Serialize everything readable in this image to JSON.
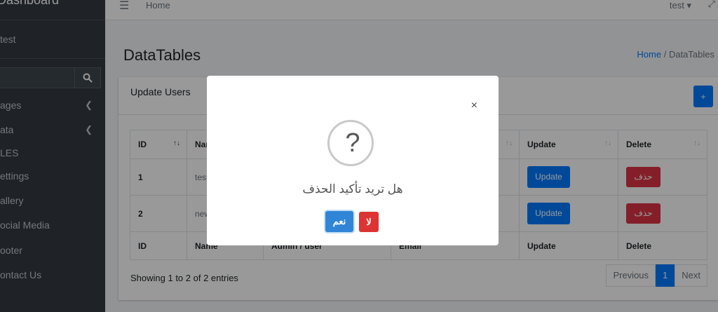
{
  "sidebar": {
    "brand": "Dashboard",
    "user_name": "test",
    "items": [
      {
        "label": "ages",
        "has_chevron": true
      },
      {
        "label": "ata",
        "has_chevron": true
      },
      {
        "label": "LES",
        "has_chevron": false
      },
      {
        "label": "ettings",
        "has_chevron": false
      },
      {
        "label": "allery",
        "has_chevron": false
      },
      {
        "label": "ocial Media",
        "has_chevron": false
      },
      {
        "label": "ooter",
        "has_chevron": false
      },
      {
        "label": "ontact Us",
        "has_chevron": false
      }
    ]
  },
  "topbar": {
    "home": "Home",
    "user": "test ▾"
  },
  "page": {
    "title": "DataTables"
  },
  "breadcrumb": {
    "home": "Home",
    "sep": "/",
    "current": "DataTables"
  },
  "card": {
    "title": "Update Users",
    "add_label": "+"
  },
  "table": {
    "headers": [
      "ID",
      "Nam",
      "",
      "",
      "Update",
      "Delete"
    ],
    "rows": [
      {
        "id": "1",
        "name": "test",
        "update": "Update",
        "delete": "حذف"
      },
      {
        "id": "2",
        "name": "new",
        "update": "Update",
        "delete": "حذف"
      }
    ],
    "footers": [
      "ID",
      "Name",
      "Admin / user",
      "Email",
      "Update",
      "Delete"
    ]
  },
  "info": "Showing 1 to 2 of 2 entries",
  "pager": {
    "previous": "Previous",
    "current": "1",
    "next": "Next"
  },
  "modal": {
    "close": "×",
    "icon": "?",
    "text": "هل تريد تأكيد الحذف",
    "confirm": "نعم",
    "cancel": "لا",
    "colors": {
      "confirm": "#3085d6",
      "cancel": "#dd3333"
    }
  }
}
